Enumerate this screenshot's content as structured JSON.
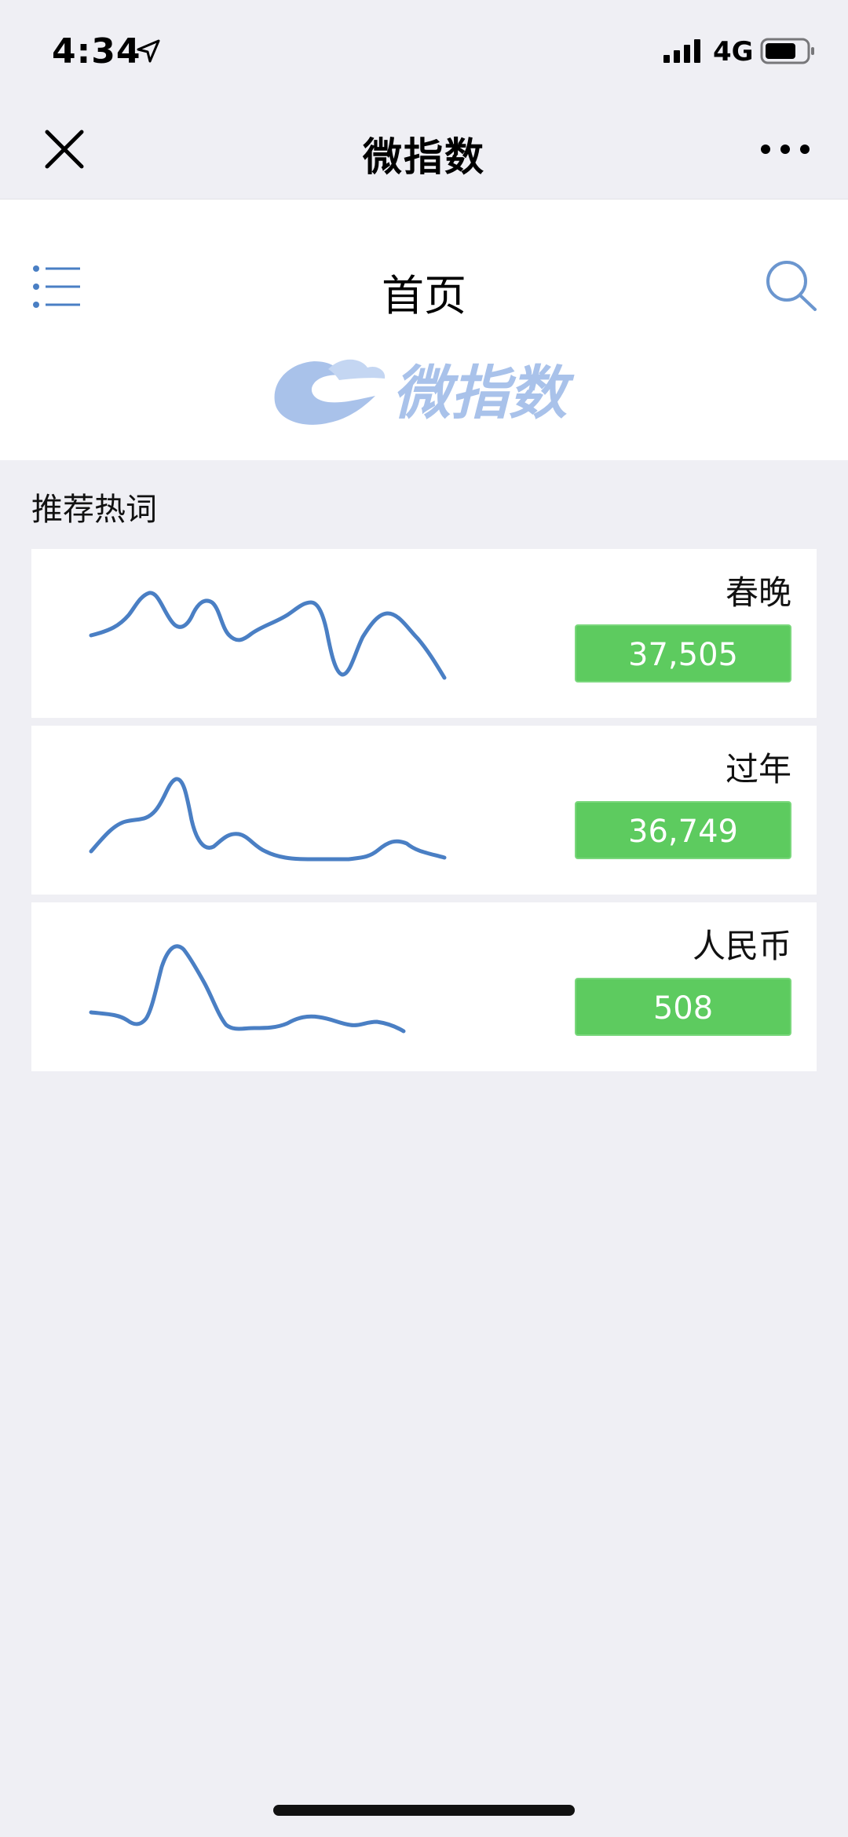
{
  "status": {
    "time": "4:34",
    "network": "4G"
  },
  "wechat": {
    "title": "微指数"
  },
  "header": {
    "title": "首页",
    "logo_text": "微指数"
  },
  "section": {
    "label": "推荐热词"
  },
  "cards": [
    {
      "word": "春晚",
      "count": "37,505"
    },
    {
      "word": "过年",
      "count": "36,749"
    },
    {
      "word": "人民币",
      "count": "508"
    }
  ],
  "colors": {
    "accent": "#4a7fc4",
    "count_bg": "#5dcb5f",
    "background": "#efeff4"
  }
}
